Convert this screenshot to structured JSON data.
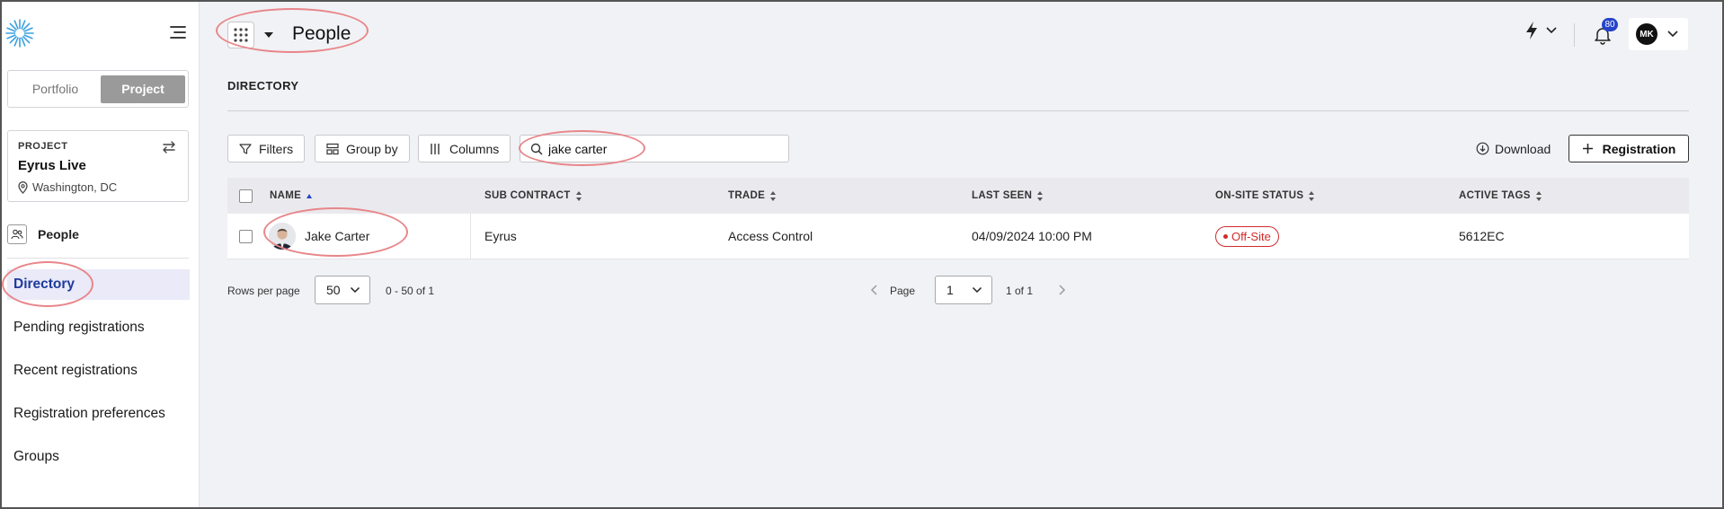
{
  "sidebar": {
    "scope_tabs": {
      "portfolio": "Portfolio",
      "project": "Project"
    },
    "project_card": {
      "label": "PROJECT",
      "name": "Eyrus Live",
      "location": "Washington, DC"
    },
    "section": "People",
    "nav": [
      "Directory",
      "Pending registrations",
      "Recent registrations",
      "Registration preferences",
      "Groups"
    ],
    "active_nav": "Directory"
  },
  "header": {
    "title": "People",
    "notifications_count": "80",
    "user_initials": "MK"
  },
  "directory": {
    "title": "DIRECTORY",
    "toolbar": {
      "filters": "Filters",
      "group_by": "Group by",
      "columns": "Columns",
      "search_value": "jake carter",
      "download": "Download",
      "registration": "Registration"
    },
    "columns": [
      "NAME",
      "SUB CONTRACT",
      "TRADE",
      "LAST SEEN",
      "ON-SITE STATUS",
      "ACTIVE TAGS"
    ],
    "rows": [
      {
        "name": "Jake Carter",
        "sub_contract": "Eyrus",
        "trade": "Access Control",
        "last_seen": "04/09/2024 10:00 PM",
        "status": "Off-Site",
        "tags": "5612EC"
      }
    ],
    "pagination": {
      "rows_per_page_label": "Rows per page",
      "rows_per_page": "50",
      "range": "0 - 50 of 1",
      "page_label": "Page",
      "page": "1",
      "page_of": "1 of 1"
    }
  },
  "colors": {
    "accent": "#2544c9",
    "active_nav_bg": "#eaeaf8",
    "status_offsite": "#d12a2a",
    "annotation": "#e8868a",
    "logo": "#3aa0e0"
  },
  "icons": [
    "logo-icon",
    "hamburger-icon",
    "swap-icon",
    "location-pin-icon",
    "people-icon",
    "apps-grid-icon",
    "bolt-icon",
    "bell-icon",
    "chevron-down-icon",
    "filter-icon",
    "group-by-icon",
    "columns-icon",
    "search-icon",
    "download-icon",
    "plus-icon",
    "chevron-left-icon",
    "chevron-right-icon"
  ]
}
